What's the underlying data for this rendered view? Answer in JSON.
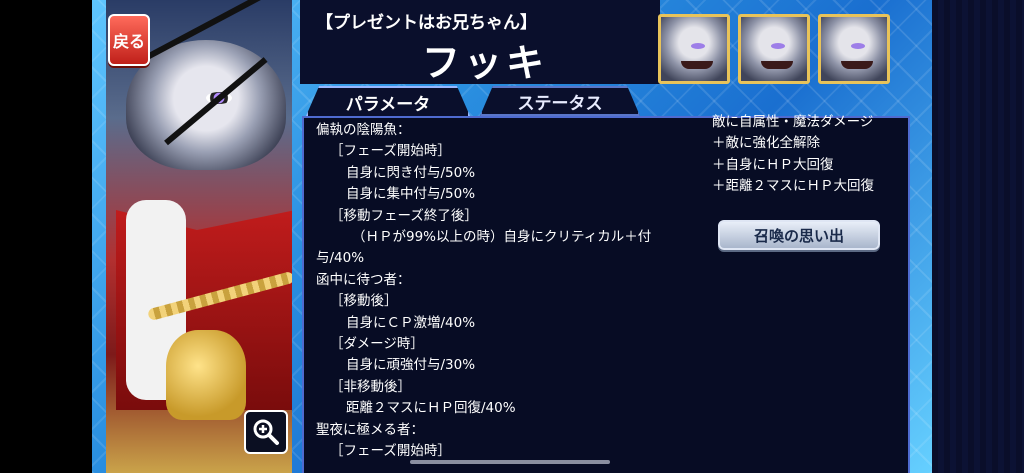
{
  "back_button": {
    "label": "戻る"
  },
  "header": {
    "subtitle": "【プレゼントはお兄ちゃん】",
    "title": "フッキ"
  },
  "portraits": [
    {
      "name": "portrait-1"
    },
    {
      "name": "portrait-2"
    },
    {
      "name": "portrait-3"
    }
  ],
  "tabs": [
    {
      "label": "パラメータ",
      "active": true
    },
    {
      "label": "ステータス",
      "active": false
    }
  ],
  "skills": [
    {
      "level": 1,
      "text": "偏執の陰陽魚："
    },
    {
      "level": 2,
      "text": "［フェーズ開始時］"
    },
    {
      "level": 3,
      "text": "自身に閃き付与/50%"
    },
    {
      "level": 3,
      "text": "自身に集中付与/50%"
    },
    {
      "level": 2,
      "text": "［移動フェーズ終了後］"
    },
    {
      "level": 4,
      "text": "（ＨＰが99%以上の時）自身にクリティカル＋付"
    },
    {
      "level": 1,
      "text": "与/40%"
    },
    {
      "level": 1,
      "text": "函中に待つ者："
    },
    {
      "level": 2,
      "text": "［移動後］"
    },
    {
      "level": 3,
      "text": "自身にＣＰ激増/40%"
    },
    {
      "level": 2,
      "text": "［ダメージ時］"
    },
    {
      "level": 3,
      "text": "自身に頑強付与/30%"
    },
    {
      "level": 2,
      "text": "［非移動後］"
    },
    {
      "level": 3,
      "text": "距離２マスにＨＰ回復/40%"
    },
    {
      "level": 1,
      "text": "聖夜に極メる者："
    },
    {
      "level": 2,
      "text": "［フェーズ開始時］"
    }
  ],
  "right_column": [
    "敵に自属性・魔法ダメージ",
    "＋敵に強化全解除",
    "＋自身にＨＰ大回復",
    "＋距離２マスにＨＰ大回復"
  ],
  "memory_button": {
    "label": "召喚の思い出"
  },
  "colors": {
    "accent_gold": "#e8c35a",
    "panel_bg": "#070c24",
    "back_red": "#c0201a"
  }
}
